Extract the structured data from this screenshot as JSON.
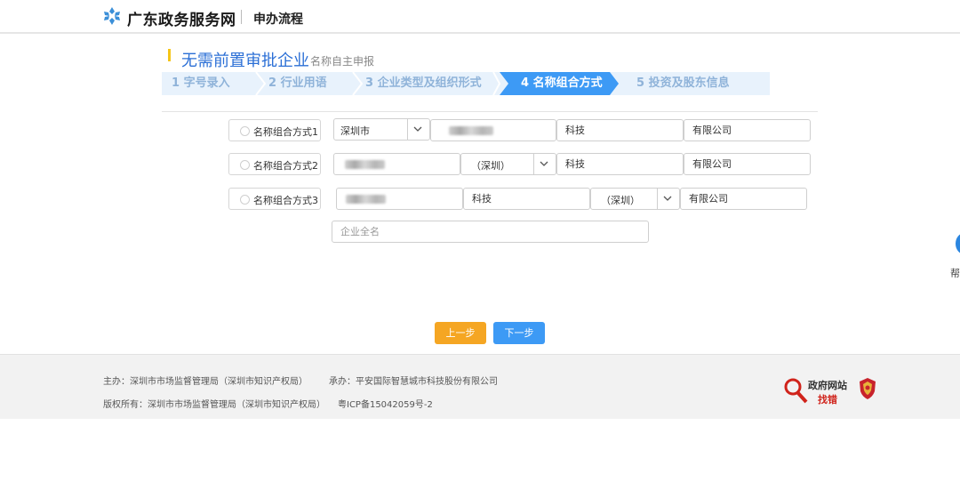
{
  "header": {
    "site_name": "广东政务服务网",
    "page_name": "申办流程",
    "logo_icon": "snowflake-logo-icon"
  },
  "title": {
    "main": "无需前置审批企业",
    "sub": "名称自主申报"
  },
  "steps": [
    {
      "label": "1 字号录入",
      "active": false
    },
    {
      "label": "2 行业用语",
      "active": false
    },
    {
      "label": "3 企业类型及组织形式",
      "active": false
    },
    {
      "label": "4 名称组合方式",
      "active": true
    },
    {
      "label": "5 投资及股东信息",
      "active": false
    }
  ],
  "rows": [
    {
      "label": "名称组合方式1",
      "select_value": "深圳市",
      "industry": "科技",
      "org_form": "有限公司"
    },
    {
      "label": "名称组合方式2",
      "select_value": "（深圳）",
      "industry": "科技",
      "org_form": "有限公司"
    },
    {
      "label": "名称组合方式3",
      "industry": "科技",
      "select_value": "（深圳）",
      "org_form": "有限公司"
    }
  ],
  "fullname": {
    "placeholder": "企业全名"
  },
  "help": {
    "label": "帮"
  },
  "buttons": {
    "prev": "上一步",
    "next": "下一步"
  },
  "footer": {
    "host": "主办：深圳市市场监督管理局（深圳市知识产权局）",
    "undertaker": "承办：平安国际智慧城市科技股份有限公司",
    "copyright": "版权所有：深圳市市场监督管理局（深圳市知识产权局）",
    "icp": "粤ICP备15042059号-2",
    "gov_title": "政府网站",
    "gov_sub": "找错"
  },
  "colors": {
    "accent_blue": "#2b6fd6",
    "step_active": "#3d9af5",
    "prev_button": "#f5a623",
    "next_button": "#3d9af5",
    "title_bar": "#f5c518"
  }
}
